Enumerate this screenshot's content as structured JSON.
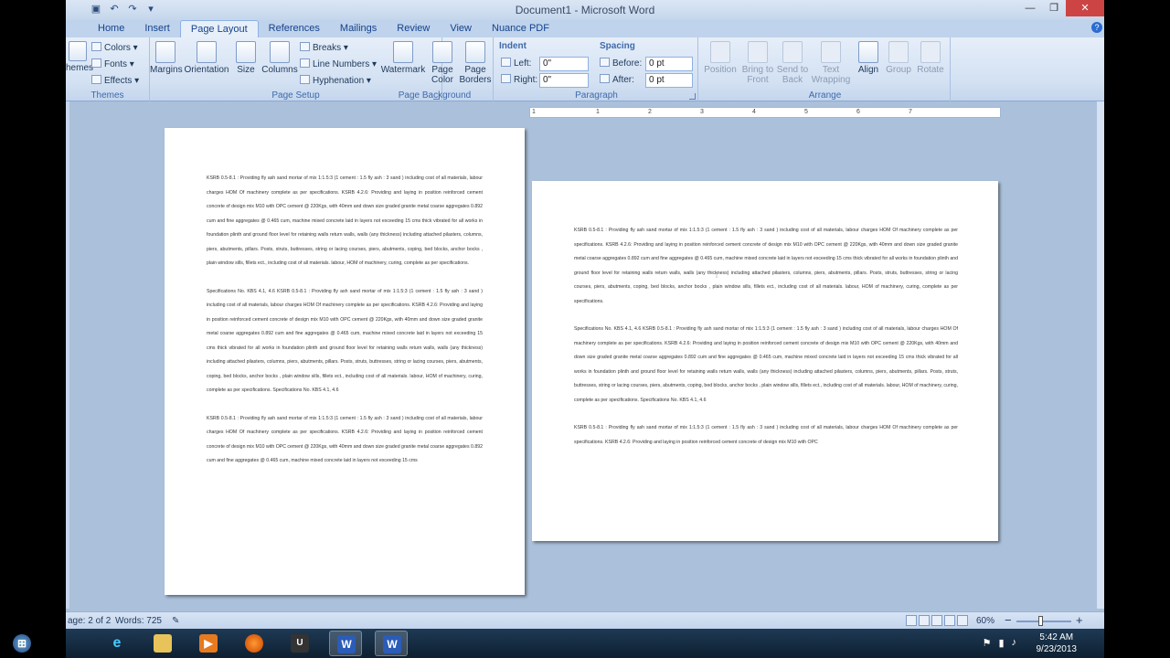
{
  "window": {
    "title": "Document1 - Microsoft Word",
    "help": "?"
  },
  "tabs": [
    "Home",
    "Insert",
    "Page Layout",
    "References",
    "Mailings",
    "Review",
    "View",
    "Nuance PDF"
  ],
  "ribbon": {
    "themes": {
      "label": "Themes",
      "themes_btn": "hemes",
      "colors": "Colors",
      "fonts": "Fonts",
      "effects": "Effects"
    },
    "page_setup": {
      "label": "Page Setup",
      "margins": "Margins",
      "orientation": "Orientation",
      "size": "Size",
      "columns": "Columns",
      "breaks": "Breaks",
      "line_numbers": "Line Numbers",
      "hyphenation": "Hyphenation"
    },
    "page_background": {
      "label": "Page Background",
      "watermark": "Watermark",
      "page_color_1": "Page",
      "page_color_2": "Color",
      "page_borders_1": "Page",
      "page_borders_2": "Borders"
    },
    "paragraph": {
      "label": "Paragraph",
      "indent": "Indent",
      "left_label": "Left:",
      "left_value": "0\"",
      "right_label": "Right:",
      "right_value": "0\"",
      "spacing": "Spacing",
      "before_label": "Before:",
      "before_value": "0 pt",
      "after_label": "After:",
      "after_value": "0 pt"
    },
    "arrange": {
      "label": "Arrange",
      "position": "Position",
      "bring_to_front_1": "Bring to",
      "bring_to_front_2": "Front",
      "send_to_back_1": "Send to",
      "send_to_back_2": "Back",
      "text_wrapping_1": "Text",
      "text_wrapping_2": "Wrapping",
      "align": "Align",
      "group": "Group",
      "rotate": "Rotate"
    }
  },
  "ruler": {
    "numbers": [
      "1",
      "1",
      "2",
      "3",
      "4",
      "5",
      "6",
      "7"
    ]
  },
  "document": {
    "page1": [
      "KSRB 0.5-8.1 : Providing fly ash sand mortar of mix 1:1.5:3 (1 cement : 1.5 fly ash : 3 sand ) including cost of all materials, labour charges HOM Of machinery complete as per specifications. KSRB 4.2.6: Providing and laying in position reinforced cement concrete of design mix M10 with OPC cement @ 220Kgs, with 40mm and down size graded granite metal coarse aggregates 0.892 cum and fine aggregates @ 0.465 cum, machine mixed concrete laid in layers not exceeding 15 cms thick vibrated for all works in foundation plinth and ground floor level for retaining walls return walls, walls (any thickness) including attached pilasters, columns, piers, abutments, pillars. Posts, struts, buttresses, string or lacing courses, piers, abutments, coping, bed blocks, anchor bocks , plain window sills, fillets ect., including cost of all materials. labour, HOM of machinery, curing, complete as per specifications.",
      "Specifications No. KBS 4.1, 4.6 KSRB 0.5-8.1 : Providing fly ash sand mortar of mix 1:1.5:3 (1 cement : 1.5 fly ash : 3 sand ) including cost of all materials, labour charges HOM Of machinery complete as per specifications. KSRB 4.2.6: Providing and laying in position reinforced cement concrete of design mix M10 with OPC cement @ 220Kgs, with 40mm and down size graded granite metal coarse aggregates 0.892 cum and fine aggregates @ 0.465 cum, machine mixed concrete laid in layers not exceeding 15 cms thick vibrated for all works in foundation plinth and ground floor level for retaining walls return walls, walls (any thickness) including attached pilasters, columns, piers, abutments, pillars. Posts, struts, buttresses, string or lacing courses, piers, abutments, coping, bed blocks, anchor bocks , plain window sills, fillets ect., including cost of all materials. labour, HOM of machinery, curing, complete as per specifications. Specifications No. KBS 4.1, 4.6",
      "KSRB 0.5-8.1 : Providing fly ash sand mortar of mix 1:1.5:3 (1 cement : 1.5 fly ash : 3 sand ) including cost of all materials, labour charges HOM Of machinery complete as per specifications. KSRB 4.2.6: Providing and laying in position reinforced cement concrete of design mix M10 with OPC cement @ 220Kgs, with 40mm and down size graded granite metal coarse aggregates 0.892 cum and fine aggregates @ 0.465 cum, machine mixed concrete laid in layers not exceeding 15 cms"
    ],
    "page2": [
      "KSRB 0.5-8.1 : Providing fly ash sand mortar of mix 1:1.5:3 (1 cement : 1.5 fly ash : 3 sand ) including cost of all materials, labour charges HOM Of machinery complete as per specifications. KSRB 4.2.6: Providing and laying in position reinforced cement concrete of design mix M10 with OPC cement @ 220Kgs, with 40mm and down size graded granite metal coarse aggregates 0.892 cum and fine aggregates @ 0.465 cum, machine mixed concrete laid in layers not exceeding 15 cms thick vibrated for all works in foundation plinth and ground floor level for retaining walls return walls, walls (any thickness) including attached pilasters, columns, piers, abutments, pillars. Posts, struts, buttresses, string or lacing courses, piers, abutments, coping, bed blocks, anchor bocks , plain window sills, fillets ect., including cost of all materials. labour, HOM of machinery, curing, complete as per specifications.",
      "Specifications No. KBS 4.1, 4.6 KSRB 0.5-8.1 : Providing fly ash sand mortar of mix 1:1.5:3 (1 cement : 1.5 fly ash : 3 sand ) including cost of all materials, labour charges HOM Of machinery complete as per specifications. KSRB 4.2.6: Providing and laying in position reinforced cement concrete of design mix M10 with OPC cement @ 220Kgs, with 40mm and down size graded granite metal coarse aggregates 0.892 cum and fine aggregates @ 0.465 cum, machine mixed concrete laid in layers not exceeding 15 cms thick vibrated for all works in foundation plinth and ground floor level for retaining walls return walls, walls (any thickness) including attached pilasters, columns, piers, abutments, pillars. Posts, struts, buttresses, string or lacing courses, piers, abutments, coping, bed blocks, anchor bocks , plain window sills, fillets ect., including cost of all materials. labour, HOM of machinery, curing, complete as per specifications. Specifications No. KBS 4.1, 4.6",
      "KSRB 0.5-8.1 : Providing fly ash sand mortar of mix 1:1.5:3 (1 cement : 1.5 fly ash : 3 sand ) including cost of all materials, labour charges HOM Of machinery complete as per specifications. KSRB 4.2.6: Providing and laying in position reinforced cement concrete of design mix M10 with OPC"
    ]
  },
  "statusbar": {
    "page": "age: 2 of 2",
    "words": "Words: 725",
    "zoom": "60%",
    "minus": "−",
    "plus": "+"
  },
  "taskbar": {
    "time": "5:42 AM",
    "date": "9/23/2013"
  },
  "colors": {
    "ribbon_bg": "#d3e1f3",
    "workspace_bg": "#abc0da",
    "taskbar_bg": "#1e3a55"
  }
}
